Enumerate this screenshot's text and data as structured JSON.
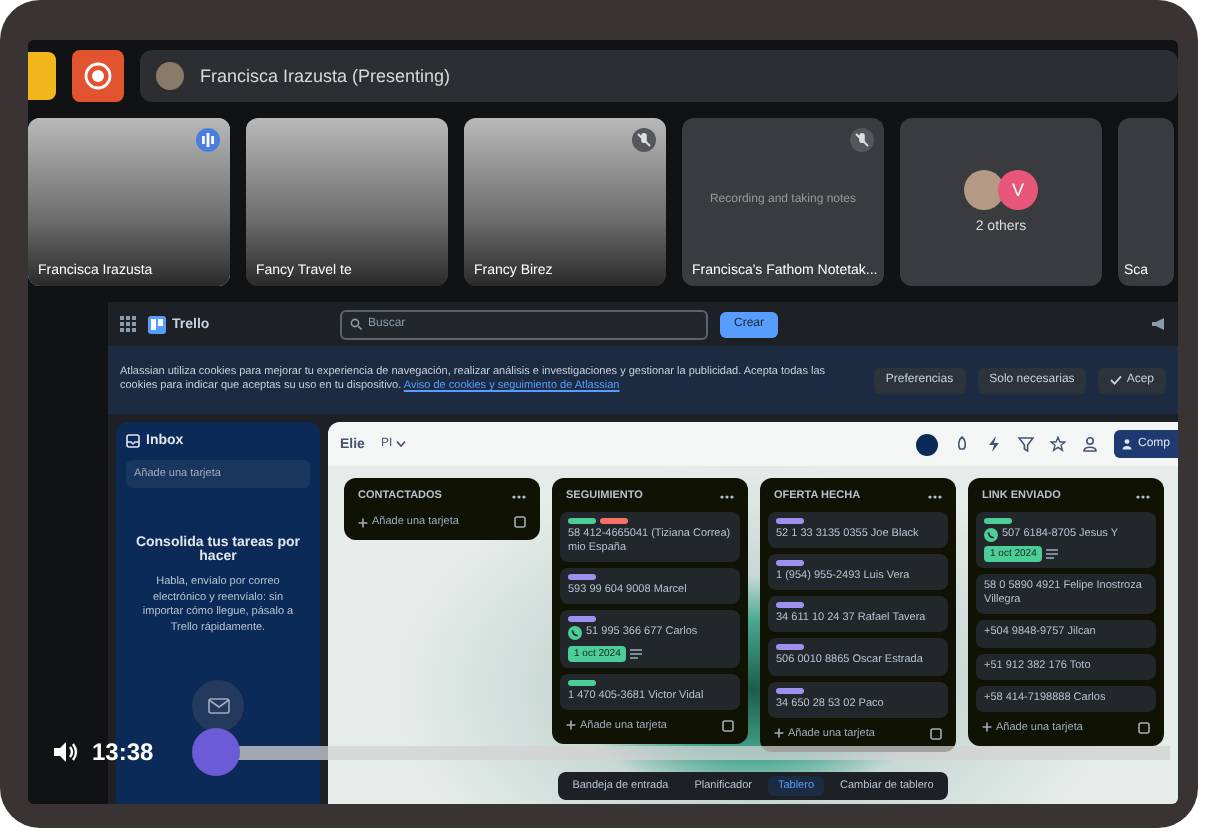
{
  "call": {
    "presenter": "Francisca Irazusta (Presenting)"
  },
  "tiles": [
    {
      "kind": "video",
      "name": "Francisca Irazusta",
      "speaking": true,
      "muted": false
    },
    {
      "kind": "video",
      "name": "Fancy Travel te",
      "speaking": false,
      "muted": false
    },
    {
      "kind": "video",
      "name": "Francy Birez",
      "speaking": false,
      "muted": true
    },
    {
      "kind": "bot",
      "caption": "Recording and taking notes",
      "name": "Francisca's Fathom Notetak...",
      "speaking": false,
      "muted": true
    },
    {
      "kind": "others",
      "avatar_letter": "V",
      "label": "2 others"
    },
    {
      "kind": "partial",
      "name": "Sca"
    }
  ],
  "trello": {
    "app_name": "Trello",
    "search_placeholder": "Buscar",
    "create_button": "Crear",
    "cookie_banner": {
      "text": "Atlassian utiliza cookies para mejorar tu experiencia de navegación, realizar análisis e investigaciones y gestionar la publicidad. Acepta todas las cookies para indicar que aceptas su uso en tu dispositivo.",
      "link": "Aviso de cookies y seguimiento de Atlassian",
      "buttons": [
        {
          "label": "Preferencias",
          "kind": "plain"
        },
        {
          "label": "Solo necesarias",
          "kind": "plain"
        },
        {
          "label": "Acep",
          "kind": "accept"
        }
      ]
    },
    "inbox": {
      "title": "Inbox",
      "add_card": "Añade una tarjeta",
      "heading": "Consolida tus tareas por hacer",
      "body": "Habla, envíalo por correo electrónico y reenvíalo: sin importar cómo llegue, pásalo a Trello rápidamente."
    },
    "board": {
      "name": "Elie",
      "view": "PI",
      "share_button": "Comp",
      "lists": [
        {
          "title": "CONTACTADOS",
          "add_card": "Añade una tarjeta"
        },
        {
          "title": "SEGUIMIENTO",
          "add_card": "Añade una tarjeta",
          "cards": [
            {
              "text": "58 412-4665041 (Tiziana Correa) mio España",
              "labels": [
                {
                  "color": "#4bce97"
                },
                {
                  "color": "#f87168"
                }
              ]
            },
            {
              "text": "593 99 604 9008 Marcel",
              "labels": [
                {
                  "color": "#9f8fef"
                }
              ]
            },
            {
              "text": "51 995 366 677 Carlos",
              "labels": [
                {
                  "color": "#9f8fef"
                }
              ],
              "contact": true,
              "due": "1 oct 2024"
            },
            {
              "text": "1 470 405-3681 Victor Vidal",
              "labels": [
                {
                  "color": "#4bce97"
                }
              ]
            }
          ]
        },
        {
          "title": "OFERTA HECHA",
          "add_card": "Añade una tarjeta",
          "cards": [
            {
              "text": "52 1 33 3135 0355 Joe Black",
              "labels": [
                {
                  "color": "#9f8fef"
                }
              ]
            },
            {
              "text": "1 (954) 955-2493 Luis Vera",
              "labels": [
                {
                  "color": "#9f8fef"
                }
              ]
            },
            {
              "text": "34 611 10 24 37 Rafael Tavera",
              "labels": [
                {
                  "color": "#9f8fef"
                }
              ]
            },
            {
              "text": "506 0010 8865 Oscar Estrada",
              "labels": [
                {
                  "color": "#9f8fef"
                }
              ]
            },
            {
              "text": "34 650 28 53 02 Paco",
              "labels": [
                {
                  "color": "#9f8fef"
                }
              ]
            }
          ]
        },
        {
          "title": "LINK ENVIADO",
          "add_card": "Añade una tarjeta",
          "cards": [
            {
              "text": "507 6184-8705 Jesus Y",
              "labels": [
                {
                  "color": "#4bce97"
                }
              ],
              "contact": true,
              "due": "1 oct 2024"
            },
            {
              "text": "58 0 5890 4921 Felipe Inostroza Villegra"
            },
            {
              "text": "+504 9848-9757 Jilcan"
            },
            {
              "text": "+51 912 382 176 Toto"
            },
            {
              "text": "+58 414-7198888 Carlos"
            }
          ]
        }
      ],
      "nav": [
        {
          "label": "Bandeja de entrada",
          "selected": false
        },
        {
          "label": "Planificador",
          "selected": false
        },
        {
          "label": "Tablero",
          "selected": true
        }
      ],
      "switch_board": "Cambiar de tablero"
    }
  },
  "player": {
    "time": "13:38",
    "level": 0.02
  }
}
